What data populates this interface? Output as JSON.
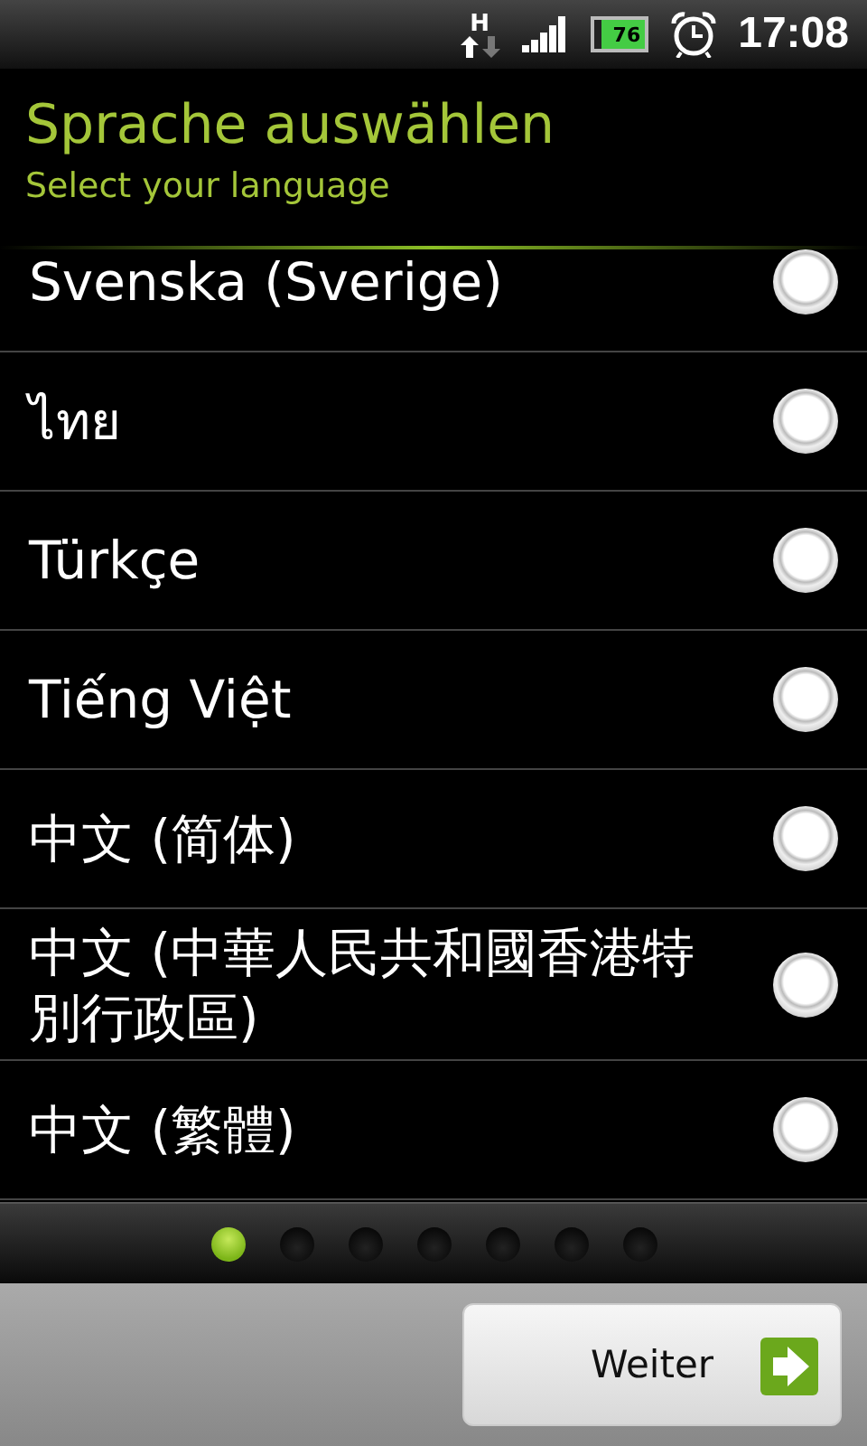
{
  "status_bar": {
    "network": "H",
    "battery": "76",
    "time": "17:08"
  },
  "header": {
    "title": "Sprache auswählen",
    "subtitle": "Select your language"
  },
  "languages": [
    {
      "name": "Svenska (Sverige)",
      "selected": false
    },
    {
      "name": "ไทย",
      "selected": false
    },
    {
      "name": "Türkçe",
      "selected": false
    },
    {
      "name": "Tiếng Việt",
      "selected": false
    },
    {
      "name": "中文 (简体)",
      "selected": false
    },
    {
      "name": "中文 (中華人民共和國香港特別行政區)",
      "selected": false
    },
    {
      "name": "中文 (繁體)",
      "selected": false
    }
  ],
  "pages": [
    {
      "selected": true
    },
    {
      "selected": false
    },
    {
      "selected": false
    },
    {
      "selected": false
    },
    {
      "selected": false
    },
    {
      "selected": false
    },
    {
      "selected": false
    }
  ],
  "buttons": [
    {
      "label": "Weiter"
    }
  ]
}
